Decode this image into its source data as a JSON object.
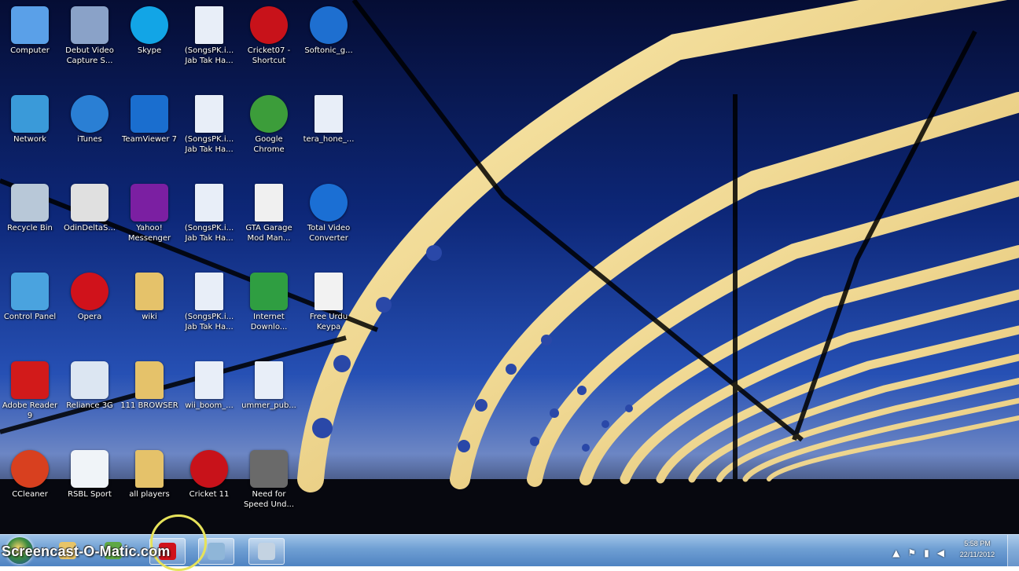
{
  "desktop": {
    "icons": [
      {
        "label": "Computer",
        "icon": "computer-icon",
        "color": "#5aa0e8"
      },
      {
        "label": "Debut Video Capture S...",
        "icon": "debut-video-icon",
        "color": "#8aa2c8"
      },
      {
        "label": "Skype",
        "icon": "skype-icon",
        "color": "#12a5e6"
      },
      {
        "label": "(SongsPK.i... Jab Tak Ha...",
        "icon": "songspk-file-icon",
        "color": "#e8eef8"
      },
      {
        "label": "Cricket07 - Shortcut",
        "icon": "cricket-ball-icon",
        "color": "#c8121a"
      },
      {
        "label": "Softonic_g...",
        "icon": "softonic-icon",
        "color": "#1e6fd0"
      },
      {
        "label": "Network",
        "icon": "network-icon",
        "color": "#3a9ad9"
      },
      {
        "label": "iTunes",
        "icon": "itunes-icon",
        "color": "#2a7fd4"
      },
      {
        "label": "TeamViewer 7",
        "icon": "teamviewer-icon",
        "color": "#1a6ecf"
      },
      {
        "label": "(SongsPK.i... Jab Tak Ha...",
        "icon": "songspk-file-icon",
        "color": "#e8eef8"
      },
      {
        "label": "Google Chrome",
        "icon": "chrome-icon",
        "color": "#3c9d3a"
      },
      {
        "label": "tera_hone_...",
        "icon": "media-file-icon",
        "color": "#e8eef8"
      },
      {
        "label": "Recycle Bin",
        "icon": "recycle-bin-icon",
        "color": "#b8c8d8"
      },
      {
        "label": "OdinDeltaS...",
        "icon": "odin-icon",
        "color": "#e0e0e0"
      },
      {
        "label": "Yahoo! Messenger",
        "icon": "yahoo-messenger-icon",
        "color": "#7b1fa2"
      },
      {
        "label": "(SongsPK.i... Jab Tak Ha...",
        "icon": "songspk-file-icon",
        "color": "#e8eef8"
      },
      {
        "label": "GTA Garage Mod Man...",
        "icon": "gta-mod-icon",
        "color": "#f0f0f0"
      },
      {
        "label": "Total Video Converter",
        "icon": "video-converter-icon",
        "color": "#1b6fd4"
      },
      {
        "label": "Control Panel",
        "icon": "control-panel-icon",
        "color": "#4aa3df"
      },
      {
        "label": "Opera",
        "icon": "opera-icon",
        "color": "#d0121b"
      },
      {
        "label": "wiki",
        "icon": "folder-icon",
        "color": "#e5c26a"
      },
      {
        "label": "(SongsPK.i... Jab Tak Ha...",
        "icon": "songspk-file-icon",
        "color": "#e8eef8"
      },
      {
        "label": "Internet Downlo...",
        "icon": "idm-icon",
        "color": "#2f9e41"
      },
      {
        "label": "Free Urdu Keypa",
        "icon": "app-window-icon",
        "color": "#f2f2f2"
      },
      {
        "label": "Adobe Reader 9",
        "icon": "adobe-reader-icon",
        "color": "#d21a1a"
      },
      {
        "label": "Reliance 3G",
        "icon": "reliance-3g-icon",
        "color": "#dce6f2"
      },
      {
        "label": "111 BROWSER",
        "icon": "folder-icon",
        "color": "#e5c26a"
      },
      {
        "label": "wii_boom_...",
        "icon": "media-file-icon",
        "color": "#e8eef8"
      },
      {
        "label": "ummer_pub...",
        "icon": "media-file-icon",
        "color": "#e8eef8"
      },
      {
        "label": "CCleaner",
        "icon": "ccleaner-icon",
        "color": "#d8401f"
      },
      {
        "label": "RSBL Sport",
        "icon": "rsbl-sport-icon",
        "color": "#f0f4f8"
      },
      {
        "label": "all players",
        "icon": "folder-icon",
        "color": "#e5c26a"
      },
      {
        "label": "Cricket 11",
        "icon": "cricket-ball-icon",
        "color": "#c8121a"
      },
      {
        "label": "Need for Speed Und...",
        "icon": "nfs-icon",
        "color": "#6a6a6a"
      }
    ]
  },
  "taskbar": {
    "watermark": "Screencast-O-Matic.com",
    "pinned": [
      {
        "icon": "media-player-icon",
        "color": "#f3a41a"
      },
      {
        "icon": "explorer-folder-icon",
        "color": "#e7c468"
      },
      {
        "icon": "media-center-icon",
        "color": "#5ea844"
      },
      {
        "icon": "opera-icon",
        "color": "#d0121b"
      },
      {
        "icon": "recording-window-icon",
        "color": "#8fb6d8"
      },
      {
        "icon": "window-icon",
        "color": "#c4d3e2"
      }
    ],
    "tray": [
      {
        "icon": "show-hidden-icons-icon",
        "glyph": "▲"
      },
      {
        "icon": "action-center-flag-icon",
        "glyph": "⚑"
      },
      {
        "icon": "network-tray-icon",
        "glyph": "▮"
      },
      {
        "icon": "volume-icon",
        "glyph": "◀"
      }
    ],
    "clock": {
      "time": "5:58 PM",
      "date": "22/11/2012"
    }
  }
}
